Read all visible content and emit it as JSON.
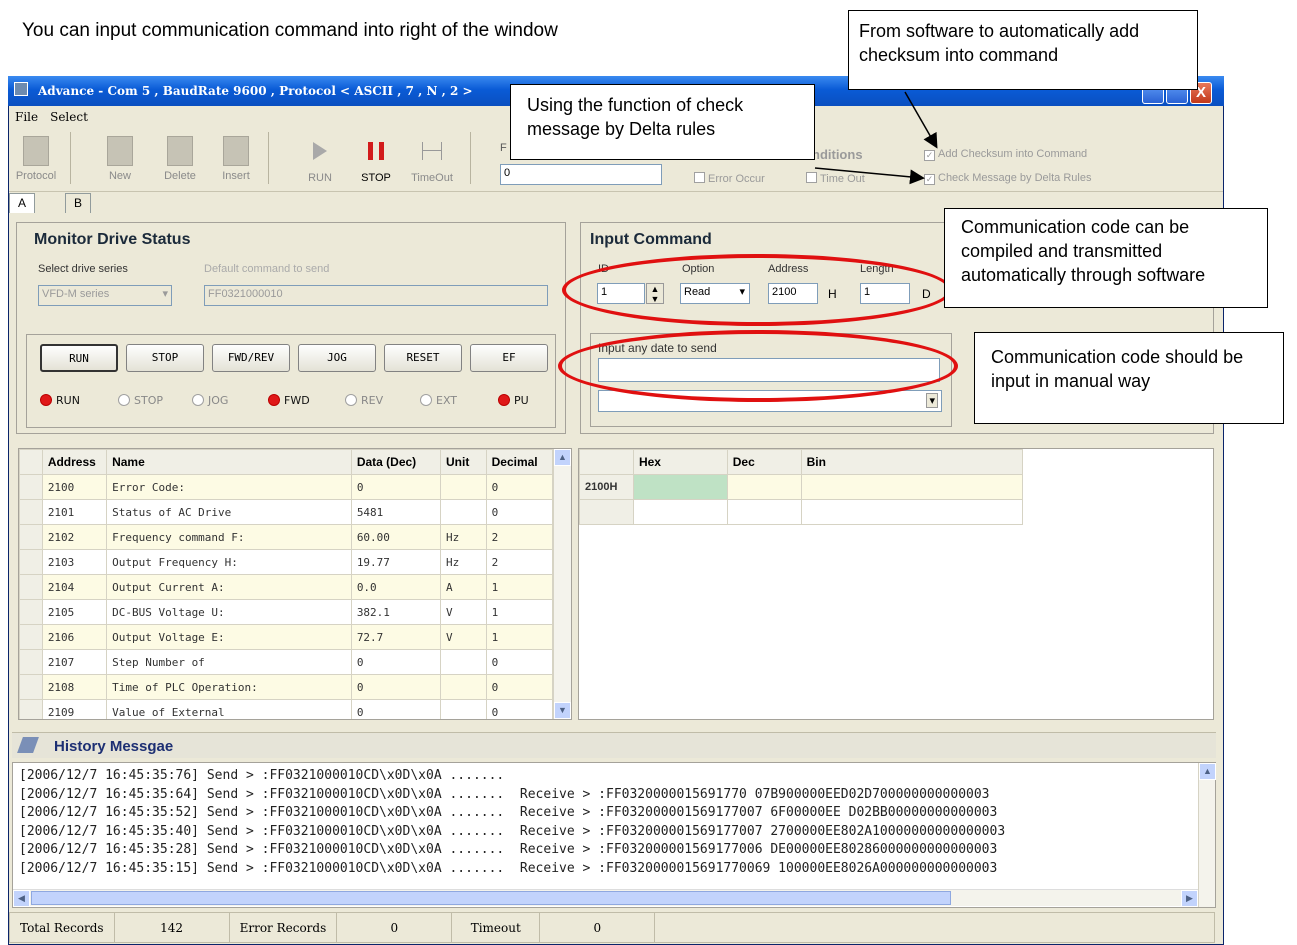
{
  "intro_text": "You can input communication command into right of the window",
  "window": {
    "title": "Advance - Com 5 , BaudRate 9600 , Protocol < ASCII , 7 , N , 2 >",
    "close_glyph": "X"
  },
  "menu": [
    "File",
    "Select"
  ],
  "toolbar": {
    "protocol": "Protocol",
    "new": "New",
    "delete": "Delete",
    "insert": "Insert",
    "run": "RUN",
    "stop": "STOP",
    "timeout": "TimeOut",
    "pe_label": "F",
    "pe_value": "0",
    "conditions_label": "nditions",
    "error_occur": "Error Occur",
    "time_out": "Time Out",
    "add_checksum": "Add Checksum into Command",
    "check_message": "Check Message by Delta Rules"
  },
  "tabs": [
    "A",
    "B"
  ],
  "monitor": {
    "title": "Monitor Drive Status",
    "select_series_label": "Select drive series",
    "series_value": "VFD-M series",
    "default_cmd_label": "Default command to send",
    "default_cmd_value": "FF0321000010",
    "buttons": [
      "RUN",
      "STOP",
      "FWD/REV",
      "JOG",
      "RESET",
      "EF"
    ],
    "indicators": [
      {
        "label": "RUN",
        "on": true
      },
      {
        "label": "STOP",
        "on": false
      },
      {
        "label": "JOG",
        "on": false
      },
      {
        "label": "FWD",
        "on": true
      },
      {
        "label": "REV",
        "on": false
      },
      {
        "label": "EXT",
        "on": false
      },
      {
        "label": "PU",
        "on": true
      }
    ]
  },
  "status_table": {
    "headers": [
      "Address",
      "Name",
      "Data (Dec)",
      "Unit",
      "Decimal"
    ],
    "rows": [
      [
        "2100",
        "Error Code:",
        "0",
        "",
        "0"
      ],
      [
        "2101",
        "Status of AC Drive",
        "5481",
        "",
        "0"
      ],
      [
        "2102",
        "Frequency command F:",
        "60.00",
        "Hz",
        "2"
      ],
      [
        "2103",
        "Output Frequency H:",
        "19.77",
        "Hz",
        "2"
      ],
      [
        "2104",
        "Output Current A:",
        "0.0",
        "A",
        "1"
      ],
      [
        "2105",
        "DC-BUS Voltage U:",
        "382.1",
        "V",
        "1"
      ],
      [
        "2106",
        "Output Voltage E:",
        "72.7",
        "V",
        "1"
      ],
      [
        "2107",
        "Step Number of",
        "0",
        "",
        "0"
      ],
      [
        "2108",
        "Time of PLC Operation:",
        "0",
        "",
        "0"
      ],
      [
        "2109",
        "Value of External",
        "0",
        "",
        "0"
      ]
    ]
  },
  "input_command": {
    "title": "Input Command",
    "id_label": "ID",
    "id_value": "1",
    "option_label": "Option",
    "option_value": "Read",
    "address_label": "Address",
    "address_value": "2100",
    "address_unit": "H",
    "length_label": "Length",
    "length_value": "1",
    "length_unit": "D",
    "free_input_label": "Input any date to send",
    "free_input_value": ""
  },
  "result_table": {
    "headers": [
      "Hex",
      "Dec",
      "Bin"
    ],
    "rows": [
      [
        "2100H",
        "",
        "",
        ""
      ],
      [
        "",
        "",
        "",
        ""
      ]
    ]
  },
  "history": {
    "title": "History Messgae",
    "lines": [
      "[2006/12/7 16:45:35:76] Send > :FF0321000010CD\\x0D\\x0A .......",
      "[2006/12/7 16:45:35:64] Send > :FF0321000010CD\\x0D\\x0A .......  Receive > :FF0320000015691770 07B900000EED02D700000000000003",
      "[2006/12/7 16:45:35:52] Send > :FF0321000010CD\\x0D\\x0A .......  Receive > :FF032000001569177007 6F00000EE D02BB00000000000003",
      "[2006/12/7 16:45:35:40] Send > :FF0321000010CD\\x0D\\x0A .......  Receive > :FF032000001569177007 2700000EE802A10000000000000003",
      "[2006/12/7 16:45:35:28] Send > :FF0321000010CD\\x0D\\x0A .......  Receive > :FF032000001569177006 DE00000EE80286000000000000003",
      "[2006/12/7 16:45:35:15] Send > :FF0321000010CD\\x0D\\x0A .......  Receive > :FF0320000015691770069 100000EE8026A000000000000003"
    ]
  },
  "statusbar": {
    "total_label": "Total Records",
    "total_value": "142",
    "error_label": "Error Records",
    "error_value": "0",
    "timeout_label": "Timeout",
    "timeout_value": "0"
  },
  "callouts": {
    "checksum": "From software to automatically add checksum into command",
    "check_message": "Using the function of check message by Delta rules",
    "auto_code": "Communication code can be compiled and transmitted automatically through software",
    "manual_code": "Communication code should be input in manual way"
  },
  "colors": {
    "accent_red": "#e01010",
    "title_blue": "#0a5bd6",
    "row_yellow": "#fdfbe4",
    "selected_cell": "#bfe2c5"
  }
}
